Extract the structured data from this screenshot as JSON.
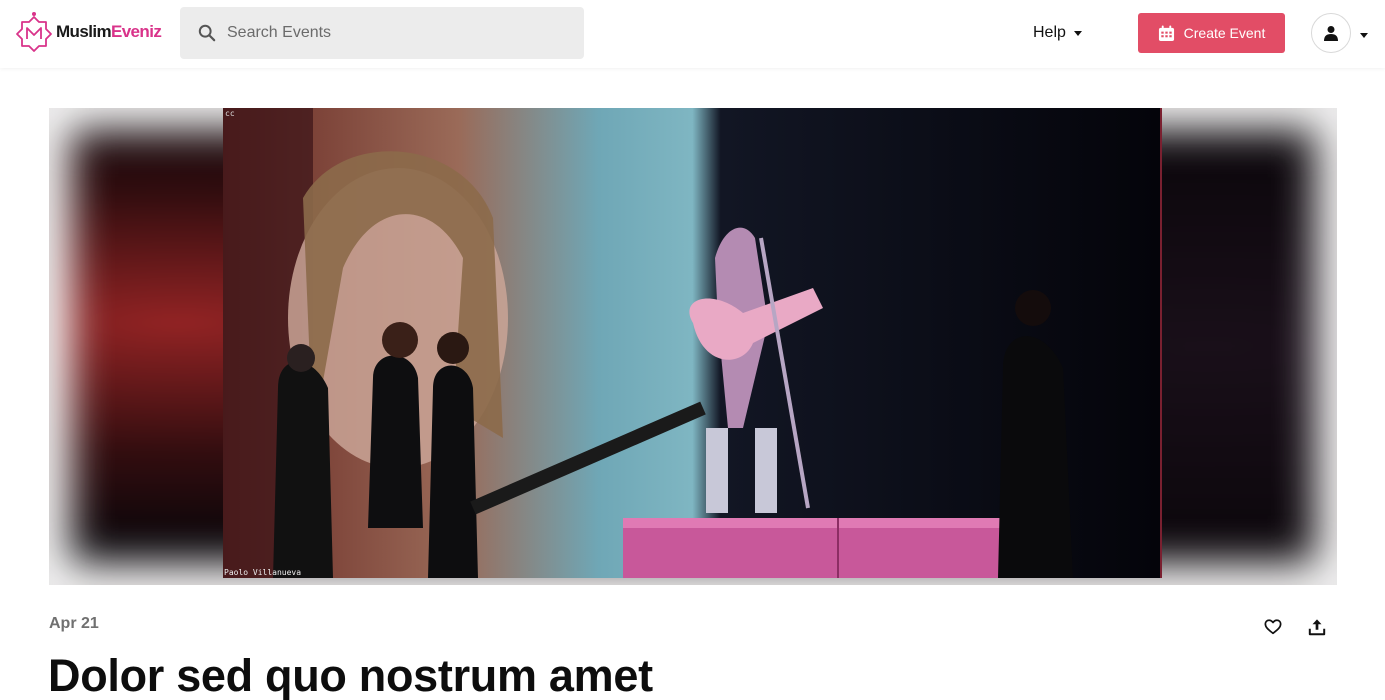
{
  "brand": {
    "name_part1": "Muslim",
    "name_part2": "Eveniz",
    "accent_color": "#d9338a"
  },
  "search": {
    "placeholder": "Search Events"
  },
  "nav": {
    "help_label": "Help",
    "create_event_label": "Create Event",
    "create_event_color": "#e24d66"
  },
  "hero": {
    "cc_text": "cc",
    "credit": "Paolo Villanueva"
  },
  "event": {
    "date": "Apr 21",
    "title": "Dolor sed quo nostrum amet"
  },
  "icons": {
    "logo": "muslimeveniz-logo-icon",
    "search": "search-icon",
    "calendar": "calendar-icon",
    "user": "user-icon",
    "like": "heart-icon",
    "share": "share-upload-icon"
  }
}
